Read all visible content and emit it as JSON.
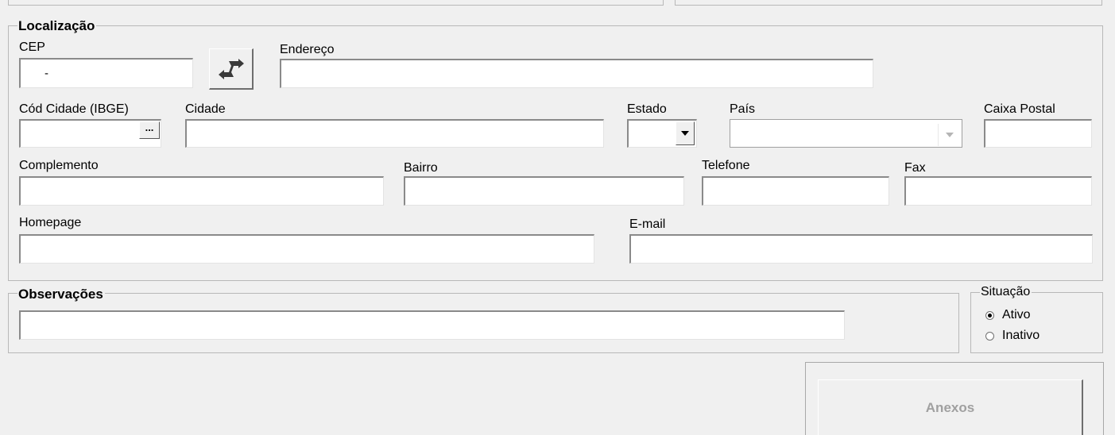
{
  "localizacao": {
    "title": "Localização",
    "cep_label": "CEP",
    "cep_value": "-",
    "endereco_label": "Endereço",
    "endereco_value": "",
    "cod_cidade_label": "Cód Cidade (IBGE)",
    "cod_cidade_value": "",
    "lookup_button_label": "...",
    "cidade_label": "Cidade",
    "cidade_value": "",
    "estado_label": "Estado",
    "estado_value": "",
    "pais_label": "País",
    "pais_value": "",
    "caixa_postal_label": "Caixa Postal",
    "caixa_postal_value": "",
    "complemento_label": "Complemento",
    "complemento_value": "",
    "bairro_label": "Bairro",
    "bairro_value": "",
    "telefone_label": "Telefone",
    "telefone_value": "",
    "fax_label": "Fax",
    "fax_value": "",
    "homepage_label": "Homepage",
    "homepage_value": "",
    "email_label": "E-mail",
    "email_value": ""
  },
  "observacoes": {
    "title": "Observações",
    "value": ""
  },
  "situacao": {
    "title": "Situação",
    "options": [
      "Ativo",
      "Inativo"
    ],
    "selected": "Ativo"
  },
  "anexos_button_label": "Anexos",
  "colors": {
    "background": "#f0f0f0",
    "disabled_text": "#a0a0a0",
    "swap_icon": "#3a3a3a"
  },
  "icons": {
    "cep_search": "swap-arrows-icon",
    "dropdown": "chevron-down-icon"
  }
}
